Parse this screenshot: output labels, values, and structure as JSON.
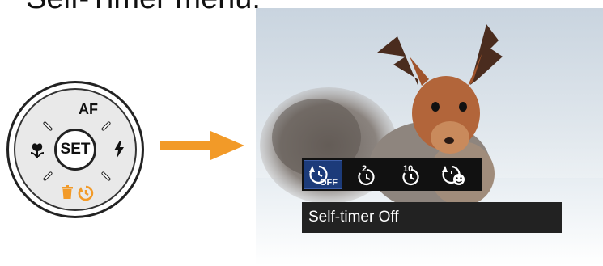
{
  "heading": "Self-Timer menu:",
  "dial": {
    "top_label": "AF",
    "center_label": "SET",
    "left_icon": "macro-flower-icon",
    "right_icon": "flash-icon",
    "bottom_icons": [
      "trash-icon",
      "self-timer-icon"
    ]
  },
  "menu": {
    "options": [
      {
        "name": "self-timer-off-icon",
        "label": "OFF",
        "selected": true
      },
      {
        "name": "timer-2s-icon",
        "label": "2",
        "selected": false
      },
      {
        "name": "timer-10s-icon",
        "label": "10",
        "selected": false
      },
      {
        "name": "smile-timer-icon",
        "label": "",
        "selected": false
      }
    ],
    "selected_caption": "Self-timer Off"
  },
  "colors": {
    "accent_orange": "#f29a28",
    "menu_selected": "#1c3b7a",
    "menu_bg": "#111111"
  }
}
